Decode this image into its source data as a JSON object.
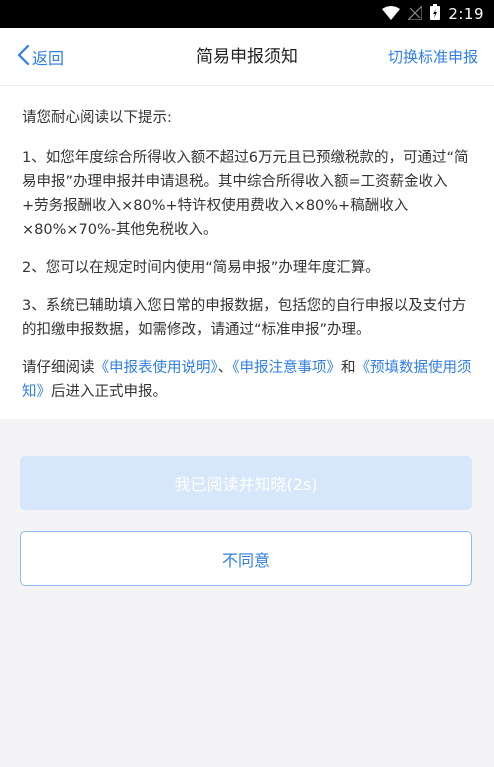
{
  "status_bar": {
    "time": "2:19",
    "icons": [
      "wifi-icon",
      "no-signal-icon",
      "battery-icon"
    ]
  },
  "nav": {
    "back_label": "返回",
    "title": "简易申报须知",
    "switch_label": "切换标准申报"
  },
  "content": {
    "intro": "请您耐心阅读以下提示:",
    "item1": "1、如您年度综合所得收入额不超过6万元且已预缴税款的，可通过“简易申报”办理申报并申请退税。其中综合所得收入额=工资薪金收入+劳务报酬收入×80%+特许权使用费收入×80%+稿酬收入×80%×70%-其他免税收入。",
    "item2": "2、您可以在规定时间内使用“简易申报”办理年度汇算。",
    "item3": "3、系统已辅助填入您日常的申报数据，包括您的自行申报以及支付方的扣缴申报数据，如需修改，请通过“标准申报”办理。",
    "read_prefix": "请仔细阅读",
    "doc1": "《申报表使用说明》",
    "sep1": "、",
    "doc2": "《申报注意事项》",
    "sep2": "和",
    "doc3": "《预填数据使用须知》",
    "read_suffix": "后进入正式申报。"
  },
  "buttons": {
    "agree_label": "我已阅读并知晓(2s)",
    "disagree_label": "不同意"
  },
  "colors": {
    "accent": "#2f7ee8",
    "agree_disabled_bg": "#d6e7fb",
    "page_bg": "#f4f4f6"
  }
}
